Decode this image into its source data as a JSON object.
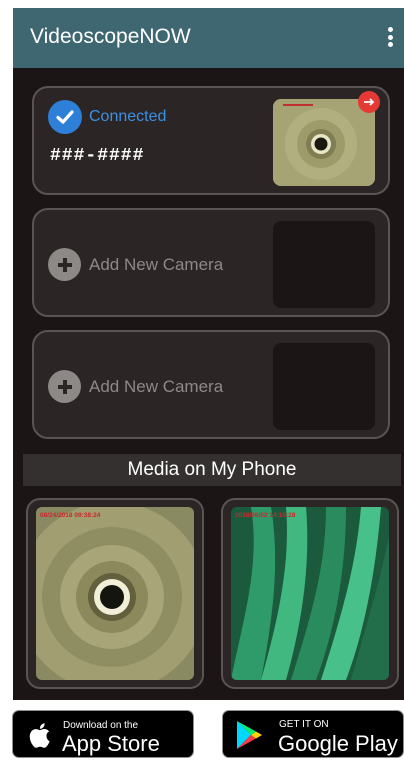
{
  "app": {
    "title": "VideoscopeNOW"
  },
  "icons": {
    "menu": "more-vert-icon",
    "check": "check-circle-icon",
    "plus": "add-circle-icon",
    "disconnect": "disconnect-icon",
    "apple": "apple-icon",
    "play": "google-play-icon"
  },
  "cameras": [
    {
      "status": "Connected",
      "serial": "###-####"
    },
    {
      "label": "Add New Camera"
    },
    {
      "label": "Add New Camera"
    }
  ],
  "media": {
    "header": "Media on My Phone",
    "items": [
      {
        "timestamp": "08/24/2018 09:38:24"
      },
      {
        "timestamp": "2018/06/02 14:18:28"
      }
    ]
  },
  "stores": {
    "apple": {
      "line1": "Download on the",
      "line2": "App Store"
    },
    "google": {
      "line1": "GET IT ON",
      "line2": "Google Play"
    }
  },
  "colors": {
    "appbar": "#3e6771",
    "accent": "#2e7fd8",
    "background": "#1b1615",
    "disconnect": "#e53935"
  }
}
